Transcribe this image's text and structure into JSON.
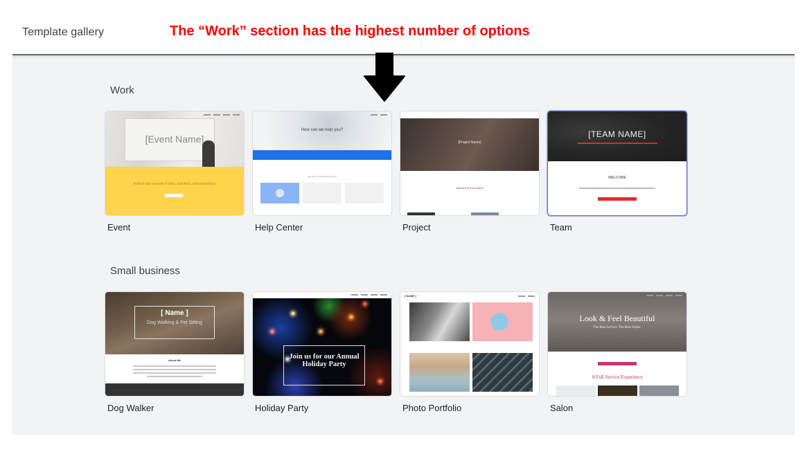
{
  "header": {
    "title": "Template gallery",
    "annotation": "The “Work” section has the highest number of options",
    "annotation_color": "#ff0000",
    "annotation_arrow": "down-arrow-icon"
  },
  "sections": [
    {
      "label": "Work",
      "templates": [
        {
          "label": "Event",
          "preview": {
            "title": "[Event Name]",
            "tagline": "A three-day summit of talks, activities, and workshops",
            "accent": "#fdd44b"
          }
        },
        {
          "label": "Help Center",
          "preview": {
            "title": "How can we help you?",
            "subheading": "Get help on the following topics",
            "accent": "#1a73e8"
          }
        },
        {
          "label": "Project",
          "preview": {
            "title": "[Project Name]",
            "subheading": "Mission of the project",
            "accent": "#a0304a"
          }
        },
        {
          "label": "Team",
          "selected": true,
          "preview": {
            "title": "[TEAM NAME]",
            "subheading": "WELCOME",
            "accent": "#d93025"
          }
        }
      ]
    },
    {
      "label": "Small business",
      "templates": [
        {
          "label": "Dog Walker",
          "preview": {
            "title": "[ Name ]",
            "subtitle": "Dog Walking & Pet Sitting",
            "subheading": "About Me"
          }
        },
        {
          "label": "Holiday Party",
          "preview": {
            "title": "Join us for our Annual Holiday Party"
          }
        },
        {
          "label": "Photo Portfolio",
          "preview": {
            "title": "[ NAME ]"
          }
        },
        {
          "label": "Salon",
          "preview": {
            "title": "Look & Feel Beautiful",
            "subtitle": "The Best Service. The Best Styles.",
            "subheading": "A Full Service Experience",
            "accent": "#c2366f"
          }
        }
      ]
    }
  ]
}
